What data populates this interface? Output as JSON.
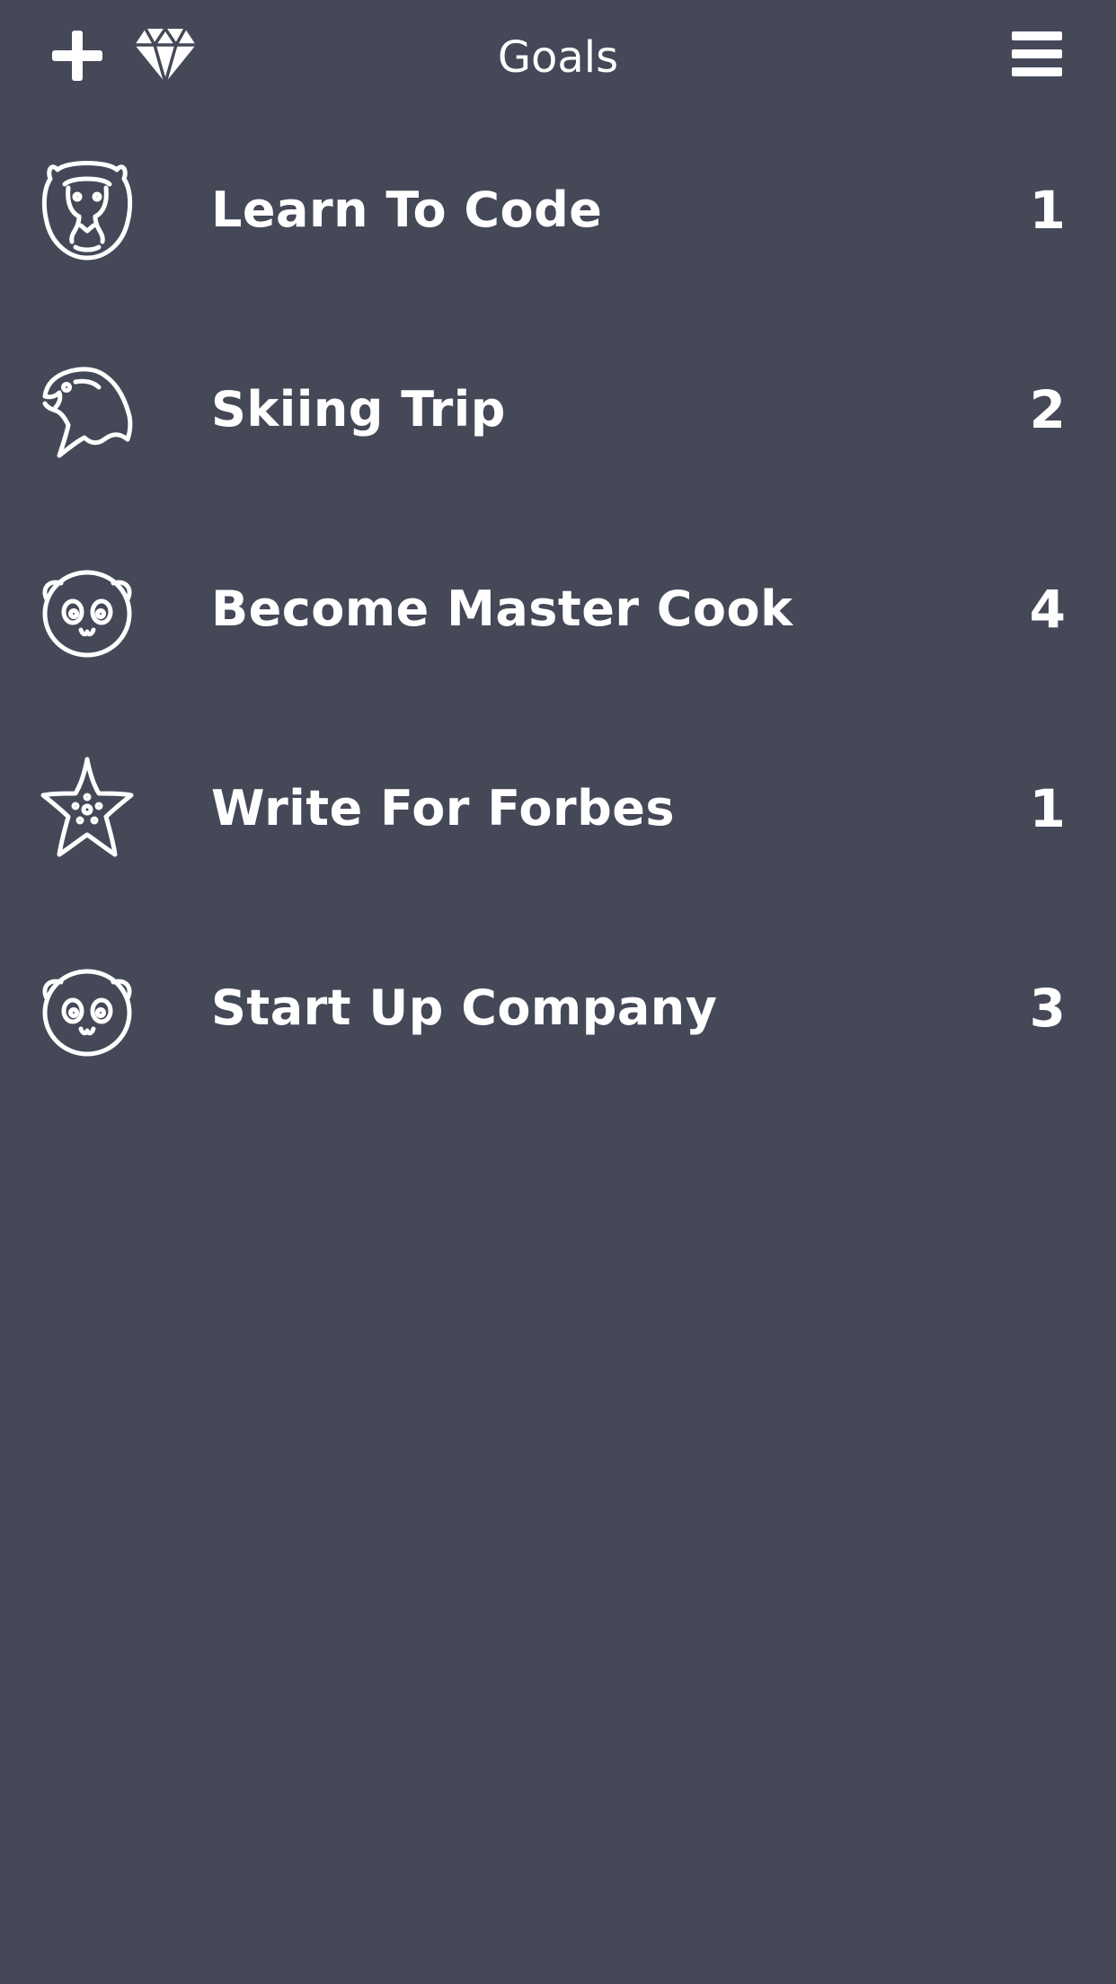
{
  "header": {
    "title": "Goals",
    "add_icon": "plus-icon",
    "gem_icon": "diamond-icon",
    "menu_icon": "hamburger-menu-icon"
  },
  "goals": [
    {
      "name": "Learn To Code",
      "count": "1",
      "icon": "lion-icon"
    },
    {
      "name": "Skiing Trip",
      "count": "2",
      "icon": "eagle-icon"
    },
    {
      "name": "Become Master Cook",
      "count": "4",
      "icon": "panda-icon"
    },
    {
      "name": "Write For Forbes",
      "count": "1",
      "icon": "starfish-icon"
    },
    {
      "name": "Start Up Company",
      "count": "3",
      "icon": "panda-icon"
    }
  ],
  "colors": {
    "background": "#454857",
    "foreground": "#ffffff"
  }
}
